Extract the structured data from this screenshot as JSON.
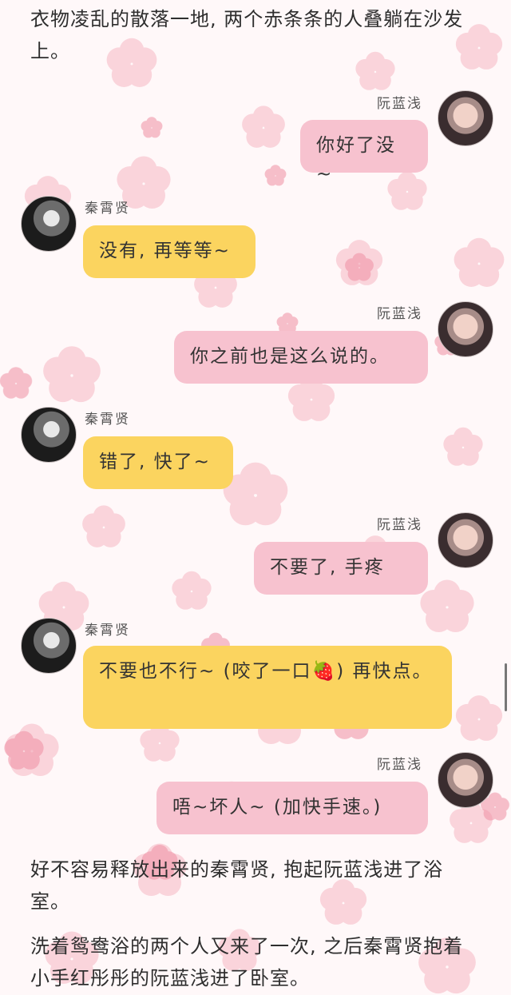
{
  "narration": {
    "top": "衣物凌乱的散落一地, 两个赤条条的人叠躺在沙发上。",
    "after_chat_1": "好不容易释放出来的秦霄贤, 抱起阮蓝浅进了浴室。",
    "after_chat_2": "洗着鸳鸯浴的两个人又来了一次, 之后秦霄贤抱着小手红彤彤的阮蓝浅进了卧室。"
  },
  "speakers": {
    "her": "阮蓝浅",
    "him": "秦霄贤"
  },
  "messages": [
    {
      "from": "her",
      "text": "你好了没~"
    },
    {
      "from": "him",
      "text": "没有, 再等等~"
    },
    {
      "from": "her",
      "text": "你之前也是这么说的。"
    },
    {
      "from": "him",
      "text": "错了, 快了~"
    },
    {
      "from": "her",
      "text": "不要了, 手疼"
    },
    {
      "from": "him",
      "text": "不要也不行~ (咬了一口🍓) 再快点。"
    },
    {
      "from": "her",
      "text": "唔~坏人~ (加快手速。)"
    }
  ],
  "colors": {
    "her_bubble": "#f7c2cf",
    "his_bubble": "#fbd45f",
    "petals": "#f4a9b8"
  }
}
